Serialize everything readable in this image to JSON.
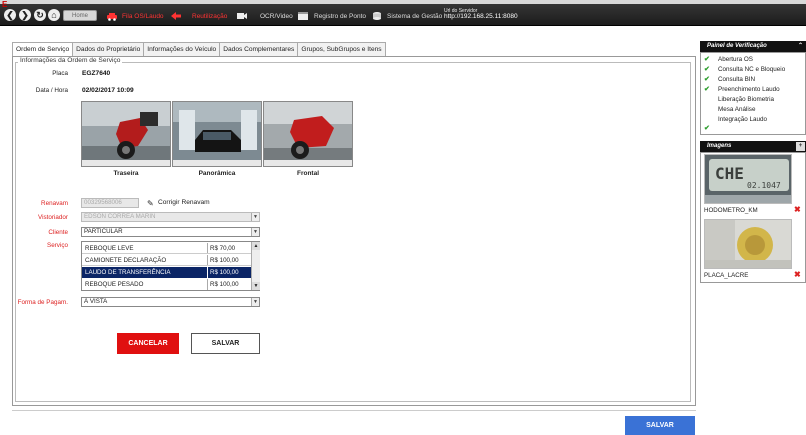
{
  "topbar": {
    "logo": "E",
    "nav_icons": [
      "back-icon",
      "forward-icon",
      "refresh-icon"
    ],
    "home_label": "Home",
    "items": [
      {
        "label": "Fila OS/Laudo",
        "color": "#ff3333"
      },
      {
        "label": "Reutilização",
        "color": "#ff3333"
      },
      {
        "label": "OCR/Video",
        "color": "#dddddd"
      },
      {
        "label": "Registro de Ponto",
        "color": "#dddddd"
      },
      {
        "label": "Sistema de Gestão",
        "color": "#dddddd"
      }
    ],
    "server_label": "Url do Servidor",
    "server_ip": "http://192.168.25.11:8080"
  },
  "tabs": [
    "Ordem de Serviço",
    "Dados do Proprietário",
    "Informações do Veículo",
    "Dados Complementares",
    "Grupos, SubGrupos e Itens"
  ],
  "form": {
    "legend": "Informações da Ordem de Serviço",
    "placa_label": "Placa",
    "placa_value": "EGZ7640",
    "datahora_label": "Data / Hora",
    "datahora_value": "02/02/2017  10:09",
    "photos": [
      "Traseira",
      "Panorâmica",
      "Frontal"
    ],
    "renavam_label": "Renavam",
    "renavam_value": "00329568006",
    "corrigir_label": "Corrigir Renavam",
    "vistoriador_label": "Vistoriador",
    "vistoriador_value": "EDSON CORREA MARIN",
    "cliente_label": "Cliente",
    "cliente_value": "PARTICULAR",
    "servico_label": "Serviço",
    "servicos": [
      {
        "name": "REBOQUE LEVE",
        "price": "R$ 70,00",
        "selected": false
      },
      {
        "name": "CAMIONETE DECLARAÇÃO",
        "price": "R$ 100,00",
        "selected": false
      },
      {
        "name": "LAUDO DE TRANSFERÊNCIA",
        "price": "R$ 100,00",
        "selected": true
      },
      {
        "name": "REBOQUE PESADO",
        "price": "R$ 100,00",
        "selected": false
      }
    ],
    "pagamento_label": "Forma de Pagam.",
    "pagamento_value": "À VISTA",
    "cancel_label": "CANCELAR",
    "save_label": "SALVAR"
  },
  "main_save_label": "SALVAR",
  "panel": {
    "title": "Painel de Verificação",
    "checks": [
      {
        "label": "Abertura OS",
        "checked": true
      },
      {
        "label": "Consulta NC e Bloqueio",
        "checked": true
      },
      {
        "label": "Consulta BIN",
        "checked": true
      },
      {
        "label": "Preenchimento Laudo",
        "checked": true
      },
      {
        "label": "Liberação Biometria",
        "checked": false
      },
      {
        "label": "Mesa Análise",
        "checked": false
      },
      {
        "label": "Integração Laudo",
        "checked": false
      }
    ],
    "images_title": "Imagens",
    "odometer_text": "CHE",
    "odometer_number": "02.1047",
    "images": [
      {
        "label": "HODOMETRO_KM"
      },
      {
        "label": "PLACA_LACRE"
      }
    ]
  },
  "colors": {
    "accent_red": "#e01010",
    "accent_blue": "#3a72d6",
    "check_green": "#2e9e2e",
    "selection_navy": "#0b2566"
  }
}
